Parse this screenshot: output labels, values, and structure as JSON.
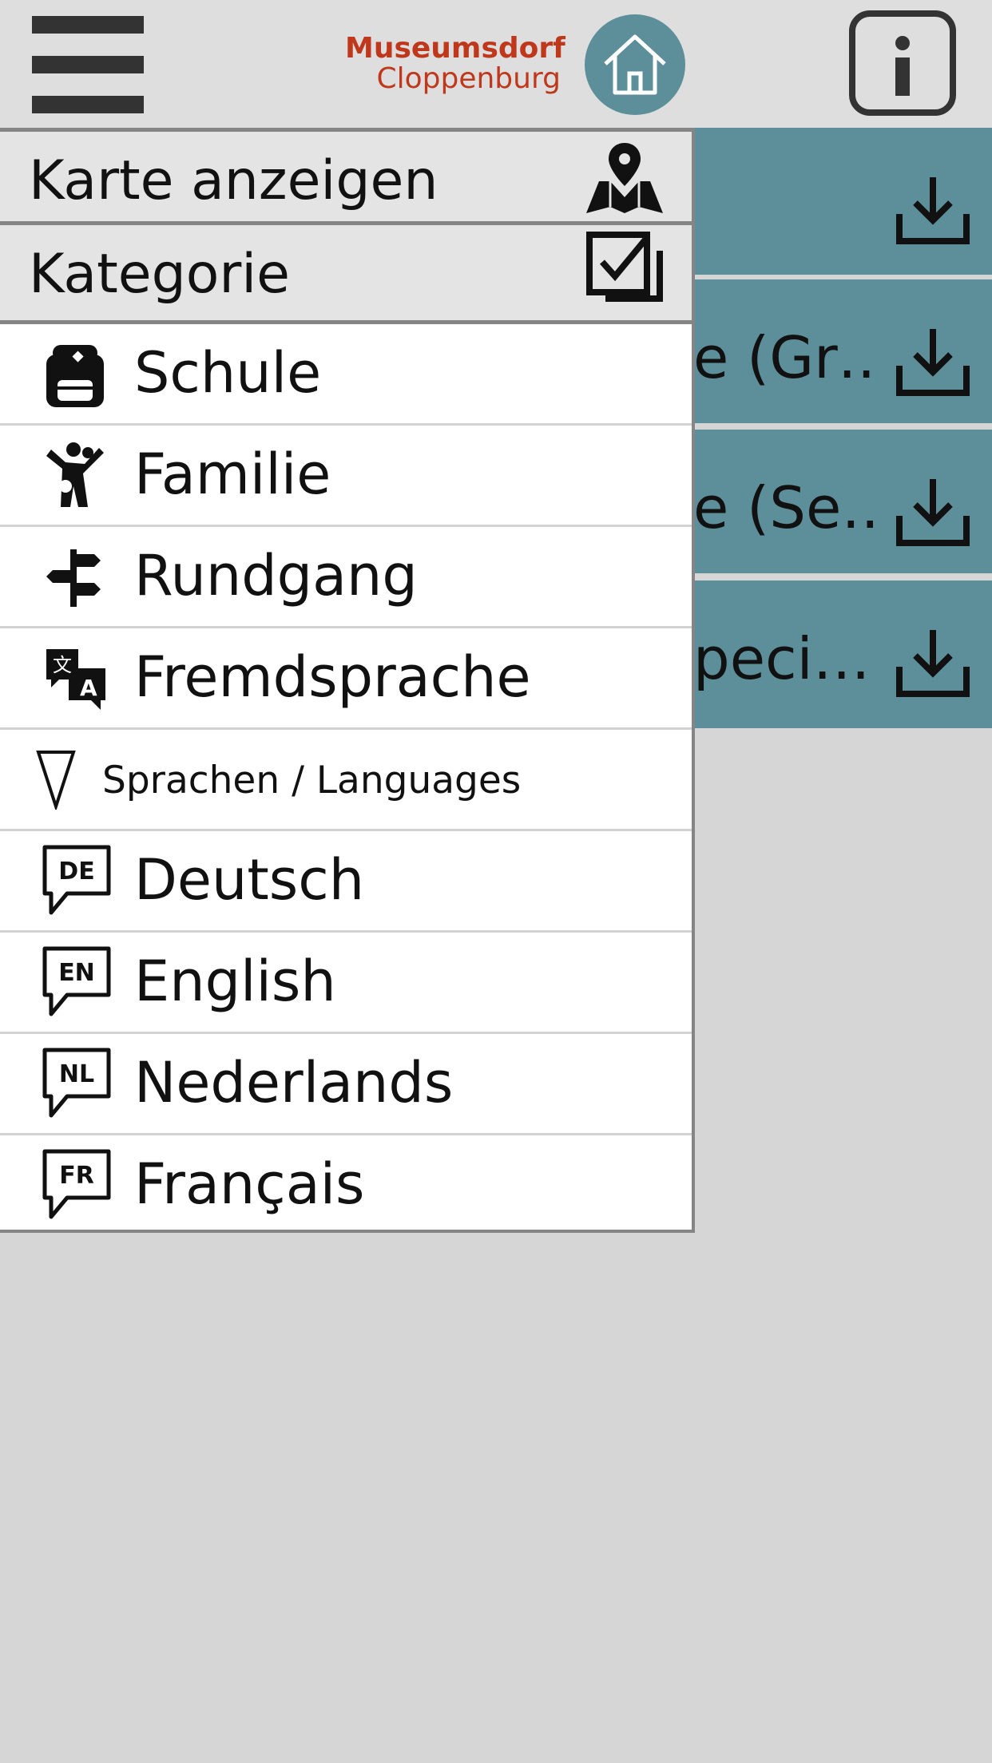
{
  "header": {
    "logo_line1": "Museumsdorf",
    "logo_line2": "Cloppenburg",
    "menu_icon": "hamburger-icon",
    "home_icon": "home-icon",
    "info_icon": "info-icon"
  },
  "colors": {
    "accent_teal": "#5d8f9b",
    "brand_red": "#c0381c",
    "header_bg": "#dedede",
    "page_bg": "#d6d6d6"
  },
  "background_list": {
    "rows": [
      {
        "text": ""
      },
      {
        "text": "e (Gr…"
      },
      {
        "text": "e (Se…"
      },
      {
        "text": "peci…"
      }
    ]
  },
  "drawer": {
    "map": {
      "label": "Karte anzeigen",
      "icon": "map-pin-icon"
    },
    "category": {
      "label": "Kategorie",
      "icon": "checkbox-stack-icon"
    },
    "categories": [
      {
        "label": "Schule",
        "icon": "backpack-icon"
      },
      {
        "label": "Familie",
        "icon": "family-icon"
      },
      {
        "label": "Rundgang",
        "icon": "signpost-icon"
      },
      {
        "label": "Fremdsprache",
        "icon": "translate-icon"
      }
    ],
    "languages_section": {
      "label": "Sprachen / Languages",
      "icon": "triangle-down-icon"
    },
    "languages": [
      {
        "label": "Deutsch",
        "code": "DE"
      },
      {
        "label": "English",
        "code": "EN"
      },
      {
        "label": "Nederlands",
        "code": "NL"
      },
      {
        "label": "Français",
        "code": "FR"
      }
    ]
  }
}
